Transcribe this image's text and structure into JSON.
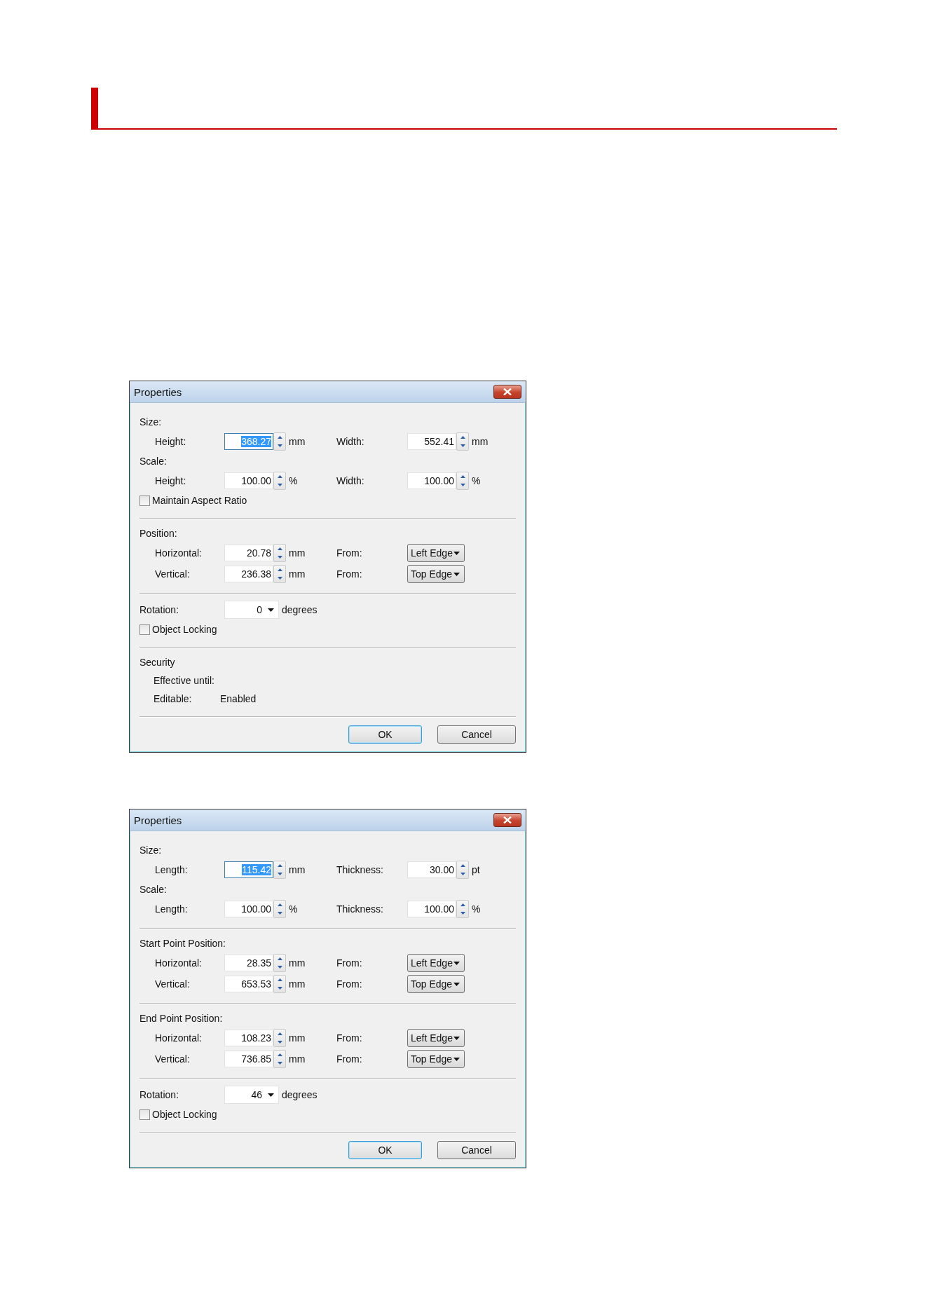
{
  "dialogs": [
    {
      "title": "Properties",
      "sections": [
        [
          {
            "kind": "heading",
            "label": "Size:"
          },
          {
            "kind": "pair",
            "left": {
              "label": "Height:",
              "field": {
                "kind": "spin",
                "value": "368.27",
                "unit": "mm",
                "selected": true
              }
            },
            "right": {
              "label": "Width:",
              "field": {
                "kind": "spin",
                "value": "552.41",
                "unit": "mm",
                "selected": false
              }
            }
          },
          {
            "kind": "heading",
            "label": "Scale:"
          },
          {
            "kind": "pair",
            "left": {
              "label": "Height:",
              "field": {
                "kind": "spin",
                "value": "100.00",
                "unit": "%",
                "selected": false
              }
            },
            "right": {
              "label": "Width:",
              "field": {
                "kind": "spin",
                "value": "100.00",
                "unit": "%",
                "selected": false
              }
            }
          },
          {
            "kind": "check",
            "label": "Maintain Aspect Ratio",
            "checked": false
          }
        ],
        [
          {
            "kind": "heading",
            "label": "Position:"
          },
          {
            "kind": "pair",
            "left": {
              "label": "Horizontal:",
              "field": {
                "kind": "spin",
                "value": "20.78",
                "unit": "mm",
                "selected": false
              }
            },
            "right": {
              "label": "From:",
              "field": {
                "kind": "select",
                "value": "Left Edge"
              }
            }
          },
          {
            "kind": "pair",
            "left": {
              "label": "Vertical:",
              "field": {
                "kind": "spin",
                "value": "236.38",
                "unit": "mm",
                "selected": false
              }
            },
            "right": {
              "label": "From:",
              "field": {
                "kind": "select",
                "value": "Top Edge"
              }
            }
          }
        ],
        [
          {
            "kind": "top",
            "label": "Rotation:",
            "field": {
              "kind": "combo",
              "value": "0",
              "unit": "degrees"
            }
          },
          {
            "kind": "check",
            "label": "Object Locking",
            "checked": false
          }
        ],
        [
          {
            "kind": "heading",
            "label": "Security"
          },
          {
            "kind": "info",
            "label": "Effective until:"
          },
          {
            "kind": "info",
            "label": "Editable:",
            "value": "Enabled"
          }
        ]
      ],
      "buttons": [
        {
          "label": "OK",
          "default": true
        },
        {
          "label": "Cancel",
          "default": false
        }
      ]
    },
    {
      "title": "Properties",
      "sections": [
        [
          {
            "kind": "heading",
            "label": "Size:"
          },
          {
            "kind": "pair",
            "left": {
              "label": "Length:",
              "field": {
                "kind": "spin",
                "value": "115.42",
                "unit": "mm",
                "selected": true
              }
            },
            "right": {
              "label": "Thickness:",
              "field": {
                "kind": "spin",
                "value": "30.00",
                "unit": "pt",
                "selected": false
              }
            }
          },
          {
            "kind": "heading",
            "label": "Scale:"
          },
          {
            "kind": "pair",
            "left": {
              "label": "Length:",
              "field": {
                "kind": "spin",
                "value": "100.00",
                "unit": "%",
                "selected": false
              }
            },
            "right": {
              "label": "Thickness:",
              "field": {
                "kind": "spin",
                "value": "100.00",
                "unit": "%",
                "selected": false
              }
            }
          }
        ],
        [
          {
            "kind": "heading",
            "label": "Start Point Position:"
          },
          {
            "kind": "pair",
            "left": {
              "label": "Horizontal:",
              "field": {
                "kind": "spin",
                "value": "28.35",
                "unit": "mm",
                "selected": false
              }
            },
            "right": {
              "label": "From:",
              "field": {
                "kind": "select",
                "value": "Left Edge"
              }
            }
          },
          {
            "kind": "pair",
            "left": {
              "label": "Vertical:",
              "field": {
                "kind": "spin",
                "value": "653.53",
                "unit": "mm",
                "selected": false
              }
            },
            "right": {
              "label": "From:",
              "field": {
                "kind": "select",
                "value": "Top Edge"
              }
            }
          }
        ],
        [
          {
            "kind": "heading",
            "label": "End Point Position:"
          },
          {
            "kind": "pair",
            "left": {
              "label": "Horizontal:",
              "field": {
                "kind": "spin",
                "value": "108.23",
                "unit": "mm",
                "selected": false
              }
            },
            "right": {
              "label": "From:",
              "field": {
                "kind": "select",
                "value": "Left Edge"
              }
            }
          },
          {
            "kind": "pair",
            "left": {
              "label": "Vertical:",
              "field": {
                "kind": "spin",
                "value": "736.85",
                "unit": "mm",
                "selected": false
              }
            },
            "right": {
              "label": "From:",
              "field": {
                "kind": "select",
                "value": "Top Edge"
              }
            }
          }
        ],
        [
          {
            "kind": "top",
            "label": "Rotation:",
            "field": {
              "kind": "combo",
              "value": "46",
              "unit": "degrees"
            }
          },
          {
            "kind": "check",
            "label": "Object Locking",
            "checked": false
          }
        ]
      ],
      "buttons": [
        {
          "label": "OK",
          "default": true
        },
        {
          "label": "Cancel",
          "default": false
        }
      ]
    }
  ]
}
